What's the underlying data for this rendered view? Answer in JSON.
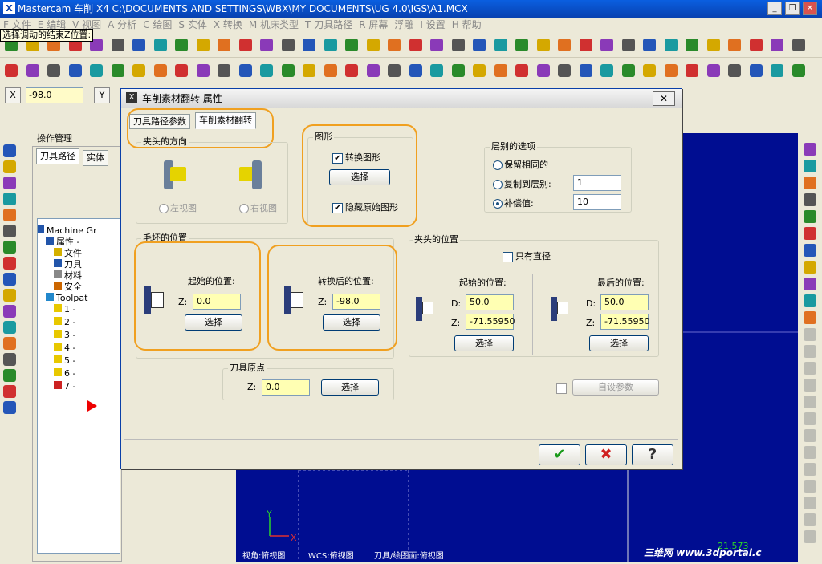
{
  "app": {
    "title": "Mastercam 车削  X4  C:\\DOCUMENTS AND SETTINGS\\WBX\\MY DOCUMENTS\\UG 4.0\\IGS\\A1.MCX"
  },
  "menu": [
    "F 文件",
    "E 编辑",
    "V 视图",
    "A 分析",
    "C 绘图",
    "S 实体",
    "X 转换",
    "M 机床类型",
    "T 刀具路径",
    "R 屏幕",
    "浮雕",
    "I 设置",
    "H 帮助"
  ],
  "hint": "选择调动的结束Z位置:",
  "coord": {
    "x_label": "X",
    "x_value": "-98.0",
    "y_label": "Y"
  },
  "opmgr": {
    "title": "操作管理",
    "tab_toolpath": "刀具路径",
    "tab_solid": "实体",
    "tree": [
      "Machine Gr",
      "属性 -",
      "文件",
      "刀具",
      "材料",
      "安全",
      "Toolpat",
      "1 -",
      "2 -",
      "3 -",
      "4 -",
      "5 -",
      "6 -",
      "7 -"
    ]
  },
  "status": [
    "视角:俯视图",
    "WCS:俯视图",
    "刀具/绘图面:俯视图"
  ],
  "watermark": "三维网 www.3dportal.c",
  "coord_readout": "21.573",
  "dialog": {
    "title": "车削素材翻转 属性",
    "tab1": "刀具路径参数",
    "tab2": "车削素材翻转",
    "chuck_dir": {
      "title": "夹头的方向",
      "left": "左视图",
      "right": "右视图"
    },
    "geometry": {
      "title": "图形",
      "convert": "转换图形",
      "select": "选择",
      "hide": "隐藏原始图形"
    },
    "level": {
      "title": "层别的选项",
      "keep": "保留相同的",
      "copy": "复制到层别:",
      "copy_value": "1",
      "offset": "补偿值:",
      "offset_value": "10"
    },
    "stock": {
      "title": "毛坯的位置",
      "start": "起始的位置:",
      "start_z": "0.0",
      "select": "选择",
      "after": "转换后的位置:",
      "after_z": "-98.0",
      "select2": "选择"
    },
    "chuck_pos": {
      "title": "夹头的位置",
      "diameter_only": "只有直径",
      "start": "起始的位置:",
      "start_d": "50.0",
      "start_z": "-71.55950",
      "end": "最后的位置:",
      "end_d": "50.0",
      "end_z": "-71.55950",
      "select": "选择",
      "select2": "选择"
    },
    "origin": {
      "title": "刀具原点",
      "z_label": "Z:",
      "z_value": "0.0",
      "select": "选择"
    },
    "labels": {
      "z": "Z:",
      "d": "D:"
    },
    "custom": "自设参数",
    "ok": "✔",
    "cancel": "✖",
    "help": "?"
  }
}
